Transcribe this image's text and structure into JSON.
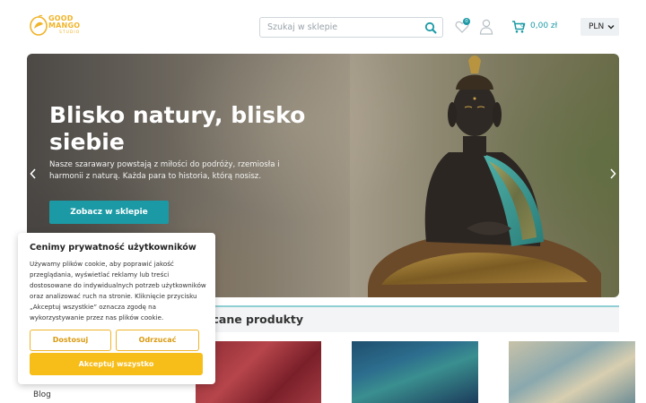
{
  "header": {
    "logo": {
      "line1": "GOOD",
      "line2": "MANGO",
      "line3": "STUDIO"
    },
    "search": {
      "placeholder": "Szukaj w sklepie"
    },
    "wishlist": {
      "count": "0",
      "icon": "heart-icon"
    },
    "account": {
      "icon": "user-icon"
    },
    "cart": {
      "count": "0",
      "total": "0,00 zł",
      "icon": "cart-icon"
    },
    "currency": {
      "selected": "PLN"
    }
  },
  "hero": {
    "title": "Blisko natury, blisko siebie",
    "description": "Nasze szarawary powstają z miłości do podróży, rzemiosła i harmonii z naturą. Każda para to historia, którą nosisz.",
    "cta_label": "Zobacz w sklepie"
  },
  "section": {
    "title_visible": "ecane produkty"
  },
  "sidebar": {
    "blog_label": "Blog"
  },
  "cookie": {
    "title": "Cenimy prywatność użytkowników",
    "text": "Używamy plików cookie, aby poprawić jakość przeglądania, wyświetlać reklamy lub treści dostosowane do indywidualnych potrzeb użytkowników oraz analizować ruch na stronie. Kliknięcie przycisku „Akceptuj wszystkie” oznacza zgodę na wykorzystywanie przez nas plików cookie.",
    "customize_label": "Dostosuj",
    "reject_label": "Odrzucać",
    "accept_label": "Akceptuj wszystko"
  },
  "colors": {
    "accent": "#1b9aa6",
    "brand": "#f0b429",
    "accept": "#f7bd18"
  }
}
